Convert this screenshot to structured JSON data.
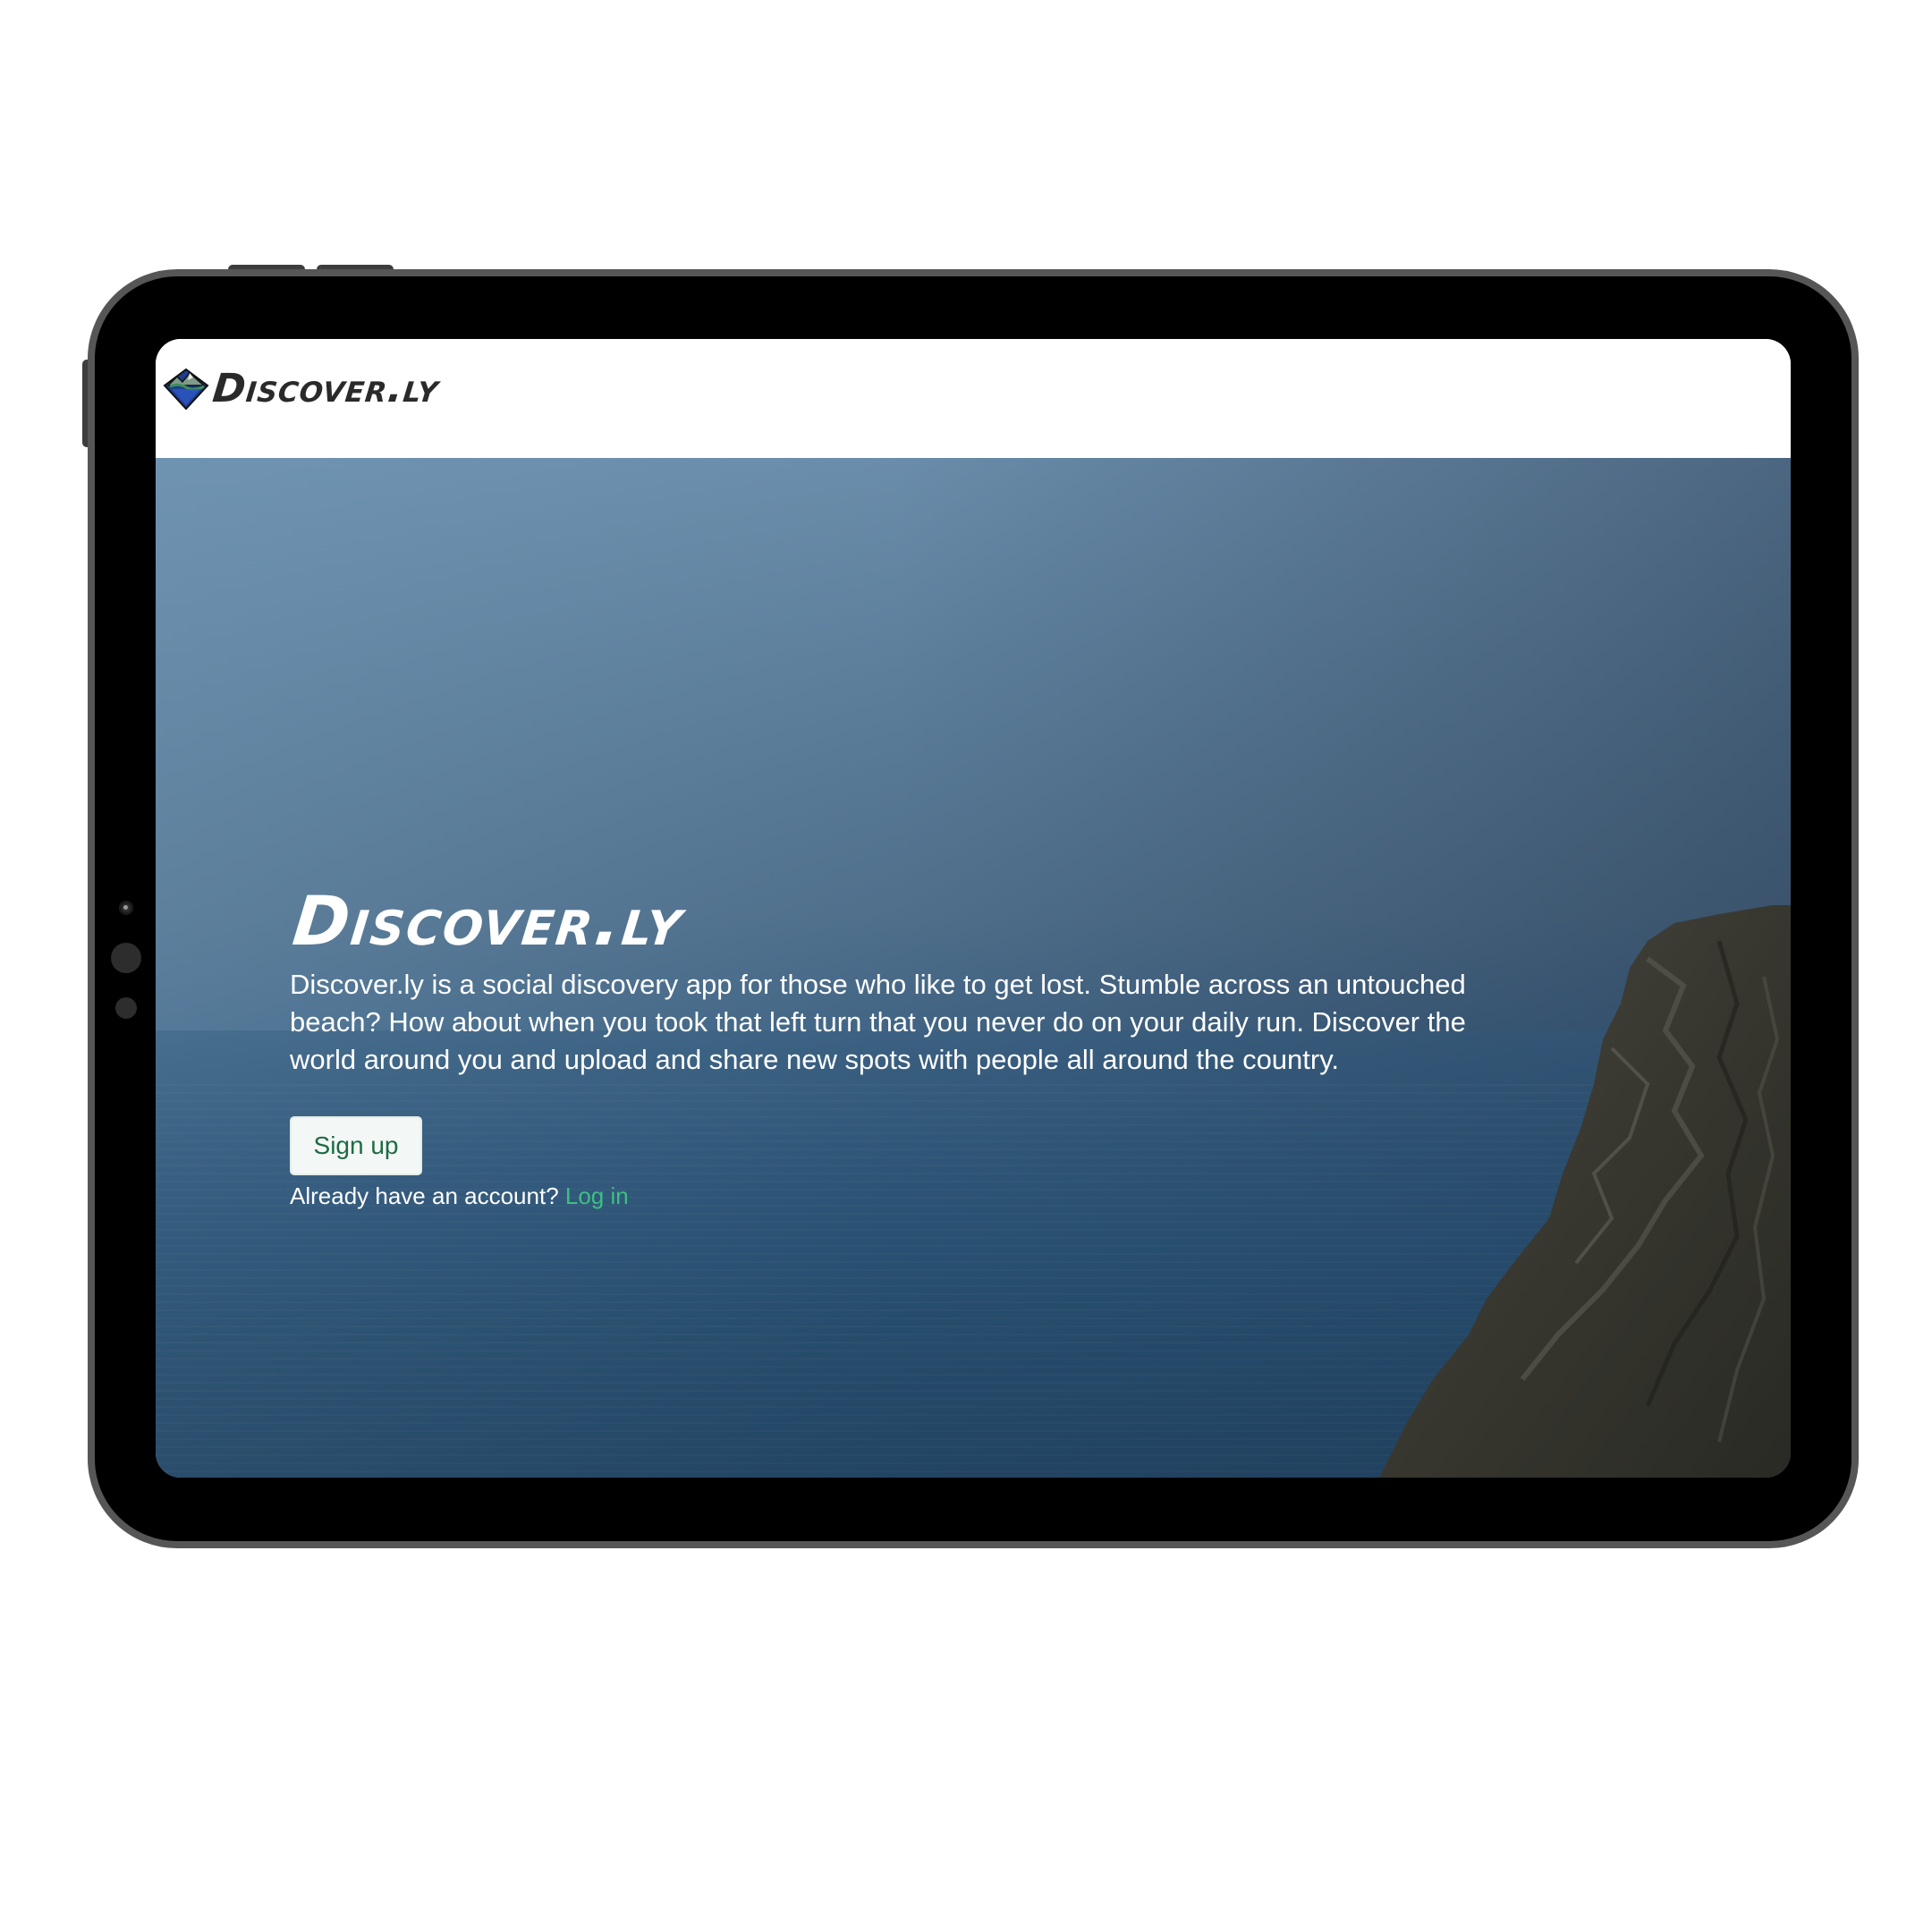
{
  "navbar": {
    "brand": "Discover.ly",
    "logo_icon": "mountain-diamond-logo-icon"
  },
  "hero": {
    "title": "Discover.ly",
    "description": "Discover.ly is a social discovery app for those who like to get lost. Stumble across an untouched beach? How about when you took that left turn that you never do on your daily run. Discover the world around you and upload and share new spots with people all around the country.",
    "signup_label": "Sign up",
    "login_prompt": "Already have an account?",
    "login_label": "Log in",
    "background": "ocean-cliff-photo"
  },
  "colors": {
    "accent_green": "#3fbf83",
    "button_text": "#1d6b45",
    "device_frame": "#565656"
  }
}
